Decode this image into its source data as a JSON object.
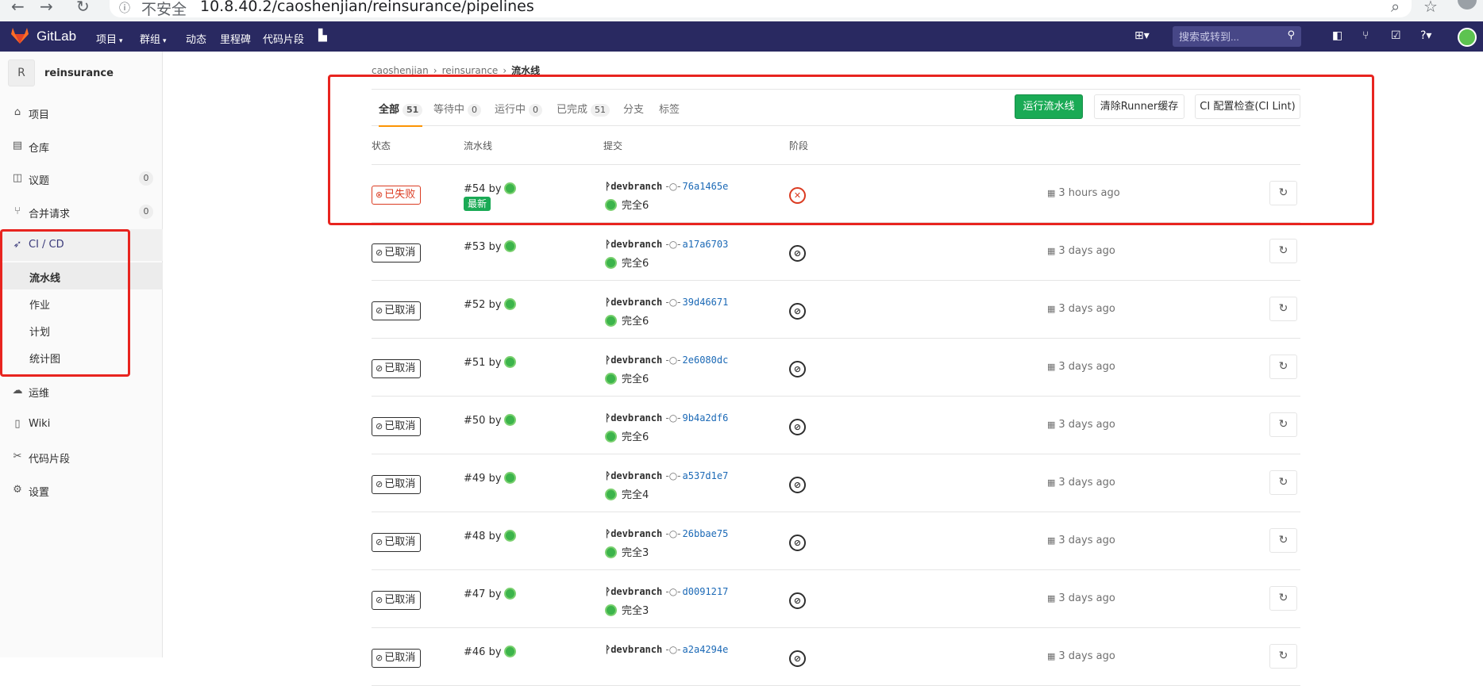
{
  "browser": {
    "security": "不安全",
    "url": "10.8.40.2/caoshenjian/reinsurance/pipelines"
  },
  "navbar": {
    "brand": "GitLab",
    "menu": [
      "项目",
      "群组",
      "动态",
      "里程碑",
      "代码片段"
    ],
    "search_placeholder": "搜索或转到..."
  },
  "sidebar": {
    "project_initial": "R",
    "project_name": "reinsurance",
    "items": [
      {
        "label": "项目",
        "icon": "home-icon"
      },
      {
        "label": "仓库",
        "icon": "doc-icon"
      },
      {
        "label": "议题",
        "icon": "issues-icon",
        "count": "0"
      },
      {
        "label": "合并请求",
        "icon": "merge-icon",
        "count": "0"
      },
      {
        "label": "CI / CD",
        "icon": "rocket-icon"
      },
      {
        "label": "运维",
        "icon": "cloud-icon"
      },
      {
        "label": "Wiki",
        "icon": "book-icon"
      },
      {
        "label": "代码片段",
        "icon": "scissors-icon"
      },
      {
        "label": "设置",
        "icon": "gear-icon"
      }
    ],
    "cicd_sub": [
      "流水线",
      "作业",
      "计划",
      "统计图"
    ]
  },
  "breadcrumb": [
    "caoshenjian",
    "reinsurance",
    "流水线"
  ],
  "tabs": [
    {
      "label": "全部",
      "count": "51"
    },
    {
      "label": "等待中",
      "count": "0"
    },
    {
      "label": "运行中",
      "count": "0"
    },
    {
      "label": "已完成",
      "count": "51"
    },
    {
      "label": "分支"
    },
    {
      "label": "标签"
    }
  ],
  "actions": {
    "run": "运行流水线",
    "clear": "清除Runner缓存",
    "lint": "CI 配置检查(CI Lint)"
  },
  "table": {
    "headers": [
      "状态",
      "流水线",
      "提交",
      "阶段"
    ],
    "by": "by",
    "latest_badge": "最新",
    "rows": [
      {
        "status": "已失败",
        "state": "failed",
        "id": "#54",
        "branch": "devbranch",
        "sha": "76a1465e",
        "msg": "完全6",
        "time": "3 hours ago"
      },
      {
        "status": "已取消",
        "state": "canceled",
        "id": "#53",
        "branch": "devbranch",
        "sha": "a17a6703",
        "msg": "完全6",
        "time": "3 days ago"
      },
      {
        "status": "已取消",
        "state": "canceled",
        "id": "#52",
        "branch": "devbranch",
        "sha": "39d46671",
        "msg": "完全6",
        "time": "3 days ago"
      },
      {
        "status": "已取消",
        "state": "canceled",
        "id": "#51",
        "branch": "devbranch",
        "sha": "2e6080dc",
        "msg": "完全6",
        "time": "3 days ago"
      },
      {
        "status": "已取消",
        "state": "canceled",
        "id": "#50",
        "branch": "devbranch",
        "sha": "9b4a2df6",
        "msg": "完全6",
        "time": "3 days ago"
      },
      {
        "status": "已取消",
        "state": "canceled",
        "id": "#49",
        "branch": "devbranch",
        "sha": "a537d1e7",
        "msg": "完全4",
        "time": "3 days ago"
      },
      {
        "status": "已取消",
        "state": "canceled",
        "id": "#48",
        "branch": "devbranch",
        "sha": "26bbae75",
        "msg": "完全3",
        "time": "3 days ago"
      },
      {
        "status": "已取消",
        "state": "canceled",
        "id": "#47",
        "branch": "devbranch",
        "sha": "d0091217",
        "msg": "完全3",
        "time": "3 days ago"
      },
      {
        "status": "已取消",
        "state": "canceled",
        "id": "#46",
        "branch": "devbranch",
        "sha": "a2a4294e",
        "msg": "",
        "time": "3 days ago"
      }
    ]
  },
  "colors": {
    "navbar": "#292961",
    "primary": "#1aaa55",
    "failed": "#db3b21",
    "annotation": "#e8241f"
  }
}
